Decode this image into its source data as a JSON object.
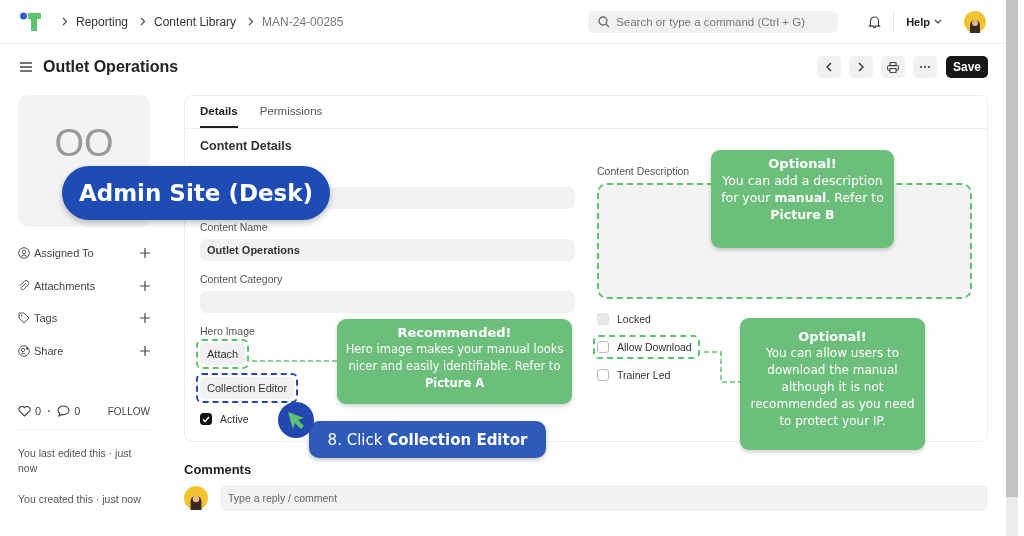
{
  "breadcrumbs": [
    "Reporting",
    "Content Library",
    "MAN-24-00285"
  ],
  "search": {
    "placeholder": "Search or type a command (Ctrl + G)"
  },
  "help": "Help",
  "page_title": "Outlet Operations",
  "save_button": "Save",
  "image_placeholder": "OO",
  "sidebar_items": [
    {
      "label": "Assigned To",
      "kind": "user"
    },
    {
      "label": "Attachments",
      "kind": "clip"
    },
    {
      "label": "Tags",
      "kind": "tag"
    },
    {
      "label": "Share",
      "kind": "share"
    }
  ],
  "likes": "0",
  "comment_count": "0",
  "follow": "FOLLOW",
  "activity": [
    "You last edited this · just now",
    "You created this · just now"
  ],
  "tabs": [
    {
      "label": "Details",
      "selected": true
    },
    {
      "label": "Permissions",
      "selected": false
    }
  ],
  "section_title": "Content Details",
  "left_fields": [
    {
      "kind": "input"
    },
    {
      "kind": "input",
      "label": "Content Name",
      "value": "Outlet Operations"
    },
    {
      "kind": "input",
      "label": "Content Category"
    },
    {
      "kind": "button",
      "label": "Hero Image",
      "button": "Attach",
      "color": "#5cc46c"
    },
    {
      "kind": "button",
      "button": "Collection Editor",
      "color": "#2747b0"
    },
    {
      "kind": "checkbox",
      "label": "Active",
      "checked": true,
      "disabled": false
    }
  ],
  "right_fields": [
    {
      "kind": "textarea",
      "label": "Content Description",
      "color": "#5cc46c"
    },
    {
      "kind": "checkbox",
      "label": "Locked",
      "checked": false,
      "disabled": true
    },
    {
      "kind": "checkbox",
      "label": "Allow Download",
      "checked": false,
      "disabled": false,
      "color": "#5cc46c"
    },
    {
      "kind": "checkbox",
      "label": "Trainer Led",
      "checked": false,
      "disabled": false
    }
  ],
  "comments": {
    "title": "Comments",
    "placeholder": "Type a reply / comment"
  },
  "annotations": {
    "badge": "Admin Site (Desk)",
    "notes": [
      {
        "title": "Optional!",
        "text": "You can add a description for your **manual**. Refer to **Picture B**"
      },
      {
        "title": "Recommended!",
        "text": "Hero image makes your manual looks nicer and easily identifiable. Refer to **Picture A**"
      },
      {
        "title": "Optional!",
        "text": "You can allow users to download the manual although it is not recommended as you need to protect your IP."
      }
    ],
    "step": "8. Click **Collection Editor**"
  }
}
